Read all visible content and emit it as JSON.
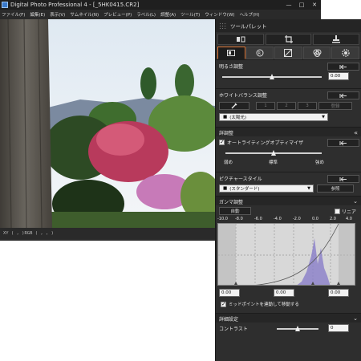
{
  "window": {
    "title": "Digital Photo Professional 4 - [_5HK0415.CR2]",
    "controls": [
      "—",
      "□",
      "✕"
    ]
  },
  "menu": [
    "ファイル(F)",
    "編集(E)",
    "表示(V)",
    "サムネイル(N)",
    "プレビュー(P)",
    "ラベル(L)",
    "調整(A)",
    "ツール(T)",
    "ウィンドウ(W)",
    "ヘルプ(H)"
  ],
  "status": {
    "text": "XY ( , )RGB ( , , )"
  },
  "palette": {
    "title": "ツールパレット",
    "tools": [
      "compare-icon",
      "crop-icon",
      "stamp-icon"
    ],
    "tabs": [
      "basic-adjust-icon",
      "nr-icon",
      "trim-icon",
      "color-icon",
      "settings-icon"
    ],
    "active_tab": 0,
    "brightness": {
      "label": "明るさ調整",
      "value": "0.00",
      "level": 0.5
    },
    "white_balance": {
      "label": "ホワイトバランス調整",
      "buttons": [
        "1",
        "2",
        "3",
        "登録"
      ],
      "preset": "(太陽光)"
    },
    "advanced": {
      "label": "詳調整"
    },
    "alo": {
      "label": "オートライティングオプティマイザ",
      "checked": true,
      "ticks": [
        "弱め",
        "標準",
        "強め"
      ],
      "level": 0.5
    },
    "picture_style": {
      "label": "ピクチャースタイル",
      "value": "(スタンダード)",
      "browse": "参照"
    },
    "gamma": {
      "label": "ガンマ調整",
      "auto": "自動",
      "linear": "リニア",
      "linear_checked": false,
      "scale": [
        "-10.0",
        "-8.0",
        "-6.0",
        "-4.0",
        "-2.0",
        "0.0",
        "2.0",
        "4.0"
      ],
      "low": "0.00",
      "mid": "0.00",
      "high": "0.00",
      "link_midpoint": "ミッドポイントを連動して移動する",
      "link_checked": true
    },
    "detail": {
      "label": "詳細設定"
    },
    "contrast": {
      "label": "コントラスト",
      "value": "0",
      "level": 0.5
    }
  },
  "colors": {
    "accent": "#e07a3a",
    "panel": "#2e2e2e",
    "field": "#f2f2f2"
  }
}
